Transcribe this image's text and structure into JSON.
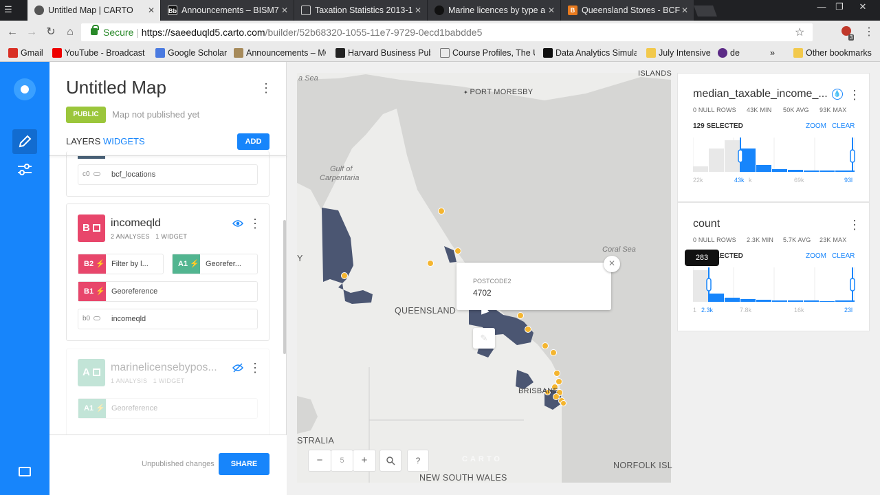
{
  "browser": {
    "tabs": [
      {
        "title": "Untitled Map | CARTO"
      },
      {
        "title": "Announcements – BISM7"
      },
      {
        "title": "Taxation Statistics 2013-1"
      },
      {
        "title": "Marine licences by type a"
      },
      {
        "title": "Queensland Stores - BCF"
      }
    ],
    "url_secure": "Secure",
    "url_sep": " | ",
    "url_host": "https://saeeduqld5.carto.com",
    "url_path": "/builder/52b68320-1055-11e7-9729-0ecd1babdde5",
    "bookmarks": [
      {
        "label": "Gmail"
      },
      {
        "label": "YouTube - Broadcast"
      },
      {
        "label": "Google Scholar"
      },
      {
        "label": "Announcements – MG"
      },
      {
        "label": "Harvard Business Pub"
      },
      {
        "label": "Course Profiles, The U"
      },
      {
        "label": "Data Analytics Simula"
      },
      {
        "label": "July Intensive"
      },
      {
        "label": "de"
      }
    ],
    "bookmarks_more": "»",
    "other_bookmarks": "Other bookmarks",
    "ext_badge": "3"
  },
  "builder": {
    "map_title": "Untitled Map",
    "public_label": "PUBLIC",
    "publish_status": "Map not published yet",
    "tab_layers": "LAYERS",
    "tab_widgets": "WIDGETS",
    "add_label": "ADD",
    "source_top": {
      "id": "c0",
      "name": "bcf_locations"
    },
    "layer_b": {
      "letter": "B",
      "name": "incomeqld",
      "meta": "2 ANALYSES   1 WIDGET",
      "analyses": [
        {
          "id": "B2",
          "label": "Filter by l..."
        },
        {
          "id": "A1",
          "label": "Georefer..."
        },
        {
          "id": "B1",
          "label": "Georeference"
        }
      ],
      "source": {
        "id": "b0",
        "name": "incomeqld"
      }
    },
    "layer_a": {
      "letter": "A",
      "name": "marinelicensebypos...",
      "meta": "1 ANALYSIS   1 WIDGET",
      "analyses": [
        {
          "id": "A1",
          "label": "Georeference"
        }
      ]
    },
    "unpublished": "Unpublished changes",
    "share_label": "SHARE"
  },
  "map": {
    "labels": {
      "islands": "ISLANDS",
      "sea_left": "a Sea",
      "port_moresby": "PORT MORESBY",
      "gulf": "Gulf of",
      "carpentaria": "Carpentaria",
      "coral_sea": "Coral Sea",
      "queensland": "QUEENSLAND",
      "brisbane": "BRISBANE",
      "australia": "STRALIA",
      "nsw": "NEW SOUTH WALES",
      "norfolk": "NORFOLK ISL",
      "y": "Y",
      "carto": "CARTO"
    },
    "popup": {
      "field": "POSTCODE2",
      "value": "4702"
    },
    "zoom_level": "5",
    "help": "?",
    "colors": {
      "polygon": "#4b5672",
      "point": "#f4b530",
      "land": "#ededeb",
      "water": "#d6d6d4"
    }
  },
  "widgets": {
    "median": {
      "title": "median_taxable_income_...",
      "null_rows": "0 NULL ROWS",
      "min": "43K MIN",
      "avg": "50K AVG",
      "max": "93K MAX",
      "selected": "129 SELECTED",
      "zoom": "ZOOM",
      "clear": "CLEAR",
      "axis": [
        "22k",
        "43k",
        "k",
        "69k",
        "93l"
      ]
    },
    "count": {
      "title": "count",
      "null_rows": "0 NULL ROWS",
      "min": "2.3K MIN",
      "avg": "5.7K AVG",
      "max": "23K MAX",
      "selected": "283 SELECTED",
      "tooltip": "283",
      "zoom": "ZOOM",
      "clear": "CLEAR",
      "axis": [
        "1",
        "2.3k",
        "7.8k",
        "16k",
        "23l"
      ]
    }
  }
}
